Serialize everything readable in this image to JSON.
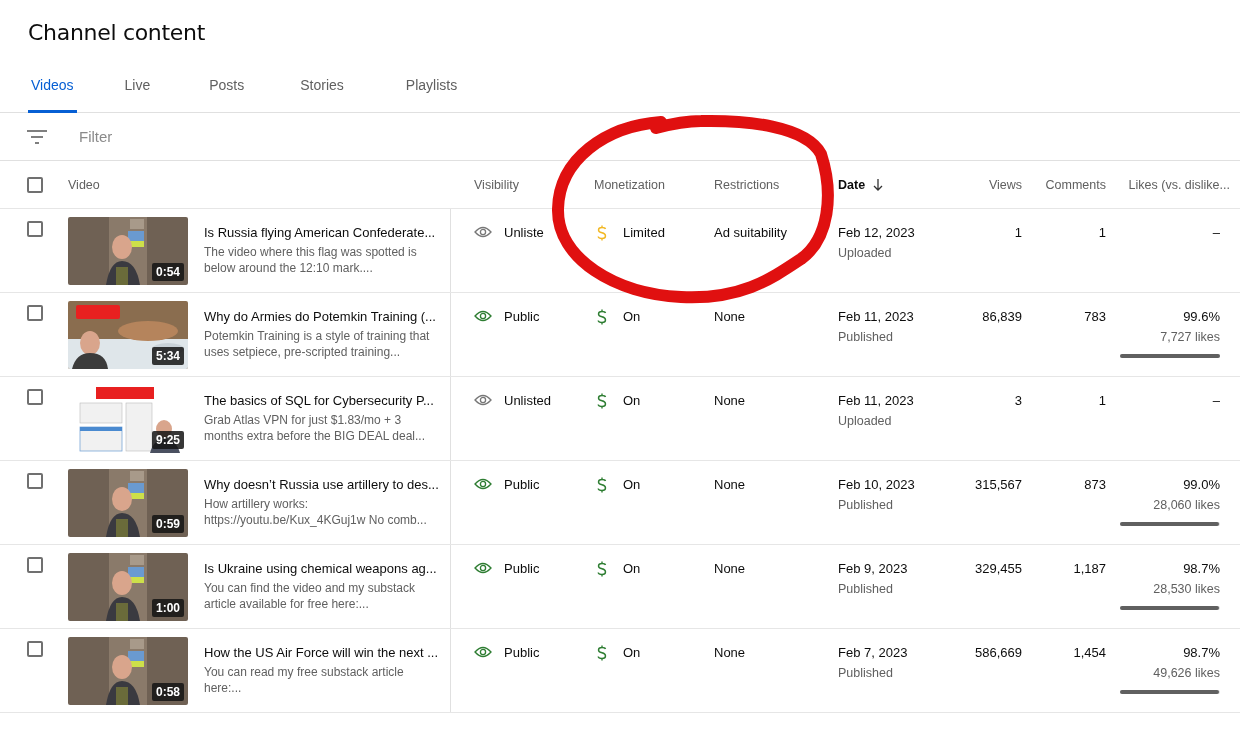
{
  "page_title": "Channel content",
  "tabs": [
    {
      "label": "Videos",
      "selected": true
    },
    {
      "label": "Live",
      "selected": false
    },
    {
      "label": "Posts",
      "selected": false
    },
    {
      "label": "Stories",
      "selected": false
    },
    {
      "label": "Playlists",
      "selected": false
    }
  ],
  "filter": {
    "placeholder": "Filter"
  },
  "table": {
    "select_all_checked": false,
    "columns": [
      {
        "label": "Video"
      },
      {
        "label": "Visibility"
      },
      {
        "label": "Monetization"
      },
      {
        "label": "Restrictions"
      },
      {
        "label": "Date",
        "sorted": true
      },
      {
        "label": "Views"
      },
      {
        "label": "Comments"
      },
      {
        "label": "Likes (vs. dislike..."
      }
    ],
    "rows": [
      {
        "checked": false,
        "thumbnail": {
          "kind": "room"
        },
        "duration": "0:54",
        "title": "Is Russia flying American Confederate...",
        "description": "The video where this flag was spotted is below around the 12:10 mark....",
        "visibility": {
          "kind": "unlisted",
          "label": "Unliste"
        },
        "monetization": {
          "kind": "limited",
          "label": "Limited"
        },
        "restrictions": "Ad suitability",
        "date": "Feb 12, 2023",
        "date_status": "Uploaded",
        "views": "1",
        "comments": "1",
        "likes": {
          "percent": "–"
        }
      },
      {
        "checked": false,
        "thumbnail": {
          "kind": "outdoor"
        },
        "duration": "5:34",
        "title": "Why do Armies do Potemkin Training (...",
        "description": "Potemkin Training is a style of training that uses setpiece, pre-scripted training...",
        "visibility": {
          "kind": "public",
          "label": "Public"
        },
        "monetization": {
          "kind": "on",
          "label": "On"
        },
        "restrictions": "None",
        "date": "Feb 11, 2023",
        "date_status": "Published",
        "views": "86,839",
        "comments": "783",
        "likes": {
          "percent": "99.6%",
          "count": "7,727 likes",
          "level": 0.996
        }
      },
      {
        "checked": false,
        "thumbnail": {
          "kind": "screen"
        },
        "duration": "9:25",
        "title": "The basics of SQL for Cybersecurity P...",
        "description": "Grab Atlas VPN for just $1.83/mo + 3 months extra before the BIG DEAL deal...",
        "visibility": {
          "kind": "unlisted",
          "label": "Unlisted"
        },
        "monetization": {
          "kind": "on",
          "label": "On"
        },
        "restrictions": "None",
        "date": "Feb 11, 2023",
        "date_status": "Uploaded",
        "views": "3",
        "comments": "1",
        "likes": {
          "percent": "–"
        }
      },
      {
        "checked": false,
        "thumbnail": {
          "kind": "room"
        },
        "duration": "0:59",
        "title": "Why doesn’t Russia use artillery to des...",
        "description": "How artillery works: https://youtu.be/Kux_4KGuj1w No comb...",
        "visibility": {
          "kind": "public",
          "label": "Public"
        },
        "monetization": {
          "kind": "on",
          "label": "On"
        },
        "restrictions": "None",
        "date": "Feb 10, 2023",
        "date_status": "Published",
        "views": "315,567",
        "comments": "873",
        "likes": {
          "percent": "99.0%",
          "count": "28,060 likes",
          "level": 0.99
        }
      },
      {
        "checked": false,
        "thumbnail": {
          "kind": "room"
        },
        "duration": "1:00",
        "title": "Is Ukraine using chemical weapons ag...",
        "description": "You can find the video and my substack article available for free here:...",
        "visibility": {
          "kind": "public",
          "label": "Public"
        },
        "monetization": {
          "kind": "on",
          "label": "On"
        },
        "restrictions": "None",
        "date": "Feb 9, 2023",
        "date_status": "Published",
        "views": "329,455",
        "comments": "1,187",
        "likes": {
          "percent": "98.7%",
          "count": "28,530 likes",
          "level": 0.987
        }
      },
      {
        "checked": false,
        "thumbnail": {
          "kind": "room"
        },
        "duration": "0:58",
        "title": "How the US Air Force will win the next ...",
        "description": "You can read my free substack article here:...",
        "visibility": {
          "kind": "public",
          "label": "Public"
        },
        "monetization": {
          "kind": "on",
          "label": "On"
        },
        "restrictions": "None",
        "date": "Feb 7, 2023",
        "date_status": "Published",
        "views": "586,669",
        "comments": "1,454",
        "likes": {
          "percent": "98.7%",
          "count": "49,626 likes",
          "level": 0.987
        }
      }
    ]
  },
  "annotation": {
    "kind": "circle"
  }
}
